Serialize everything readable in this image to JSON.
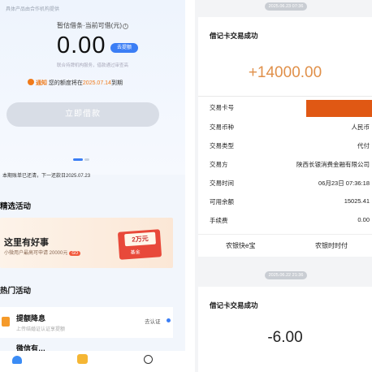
{
  "left": {
    "provider": "具体产品由合作机构提供",
    "quota_label": "暂估借条·当前可借(元)",
    "info_icon": "i",
    "amount": "0.00",
    "raise_button": "去提额",
    "subnote": "联合持牌机构服务，借款通过审查高",
    "notice_tag": "通知",
    "notice_prefix": "您的额度将在",
    "notice_date": "2025.07.14",
    "notice_suffix": "到期",
    "borrow_button": "立即借款",
    "bill_text": "本期账单已还清，下一还款日2025.07.23",
    "section_featured": "精选活动",
    "promo_title": "这里有好事",
    "promo_sub": "小微用户最高可申请 20000元",
    "promo_go": "GO",
    "coupon_value": "2万元",
    "coupon_label": "基金",
    "section_hot": "热门活动",
    "row1_title": "提额降息",
    "row1_sub": "上传结婚证认证享提额",
    "row1_action": "去认证",
    "row2_title": "微信有…",
    "tabs": [
      "home-icon",
      "gift-icon",
      "profile-icon"
    ]
  },
  "right": {
    "timestamp1": "2025.06.23 07:36",
    "card1": {
      "title": "借记卡交易成功",
      "amount": "+14000.00",
      "rows": [
        {
          "k": "交易卡号",
          "v": ""
        },
        {
          "k": "交易币种",
          "v": "人民币"
        },
        {
          "k": "交易类型",
          "v": "代付"
        },
        {
          "k": "交易方",
          "v": "陕西长银消费金融有限公司"
        },
        {
          "k": "交易时间",
          "v": "06月23日 07:36:18"
        },
        {
          "k": "可用余额",
          "v": "15025.41"
        },
        {
          "k": "手续费",
          "v": "0.00"
        }
      ],
      "btn_left": "农银快e宝",
      "btn_right": "农银时时付"
    },
    "timestamp2": "2025.06.22 21:36",
    "card2": {
      "title": "借记卡交易成功",
      "amount": "-6.00"
    }
  },
  "colors": {
    "accent_blue": "#3b7ef5",
    "income_orange": "#e0904a",
    "redact_orange": "#e05814",
    "notice_orange": "#f07a1a"
  }
}
